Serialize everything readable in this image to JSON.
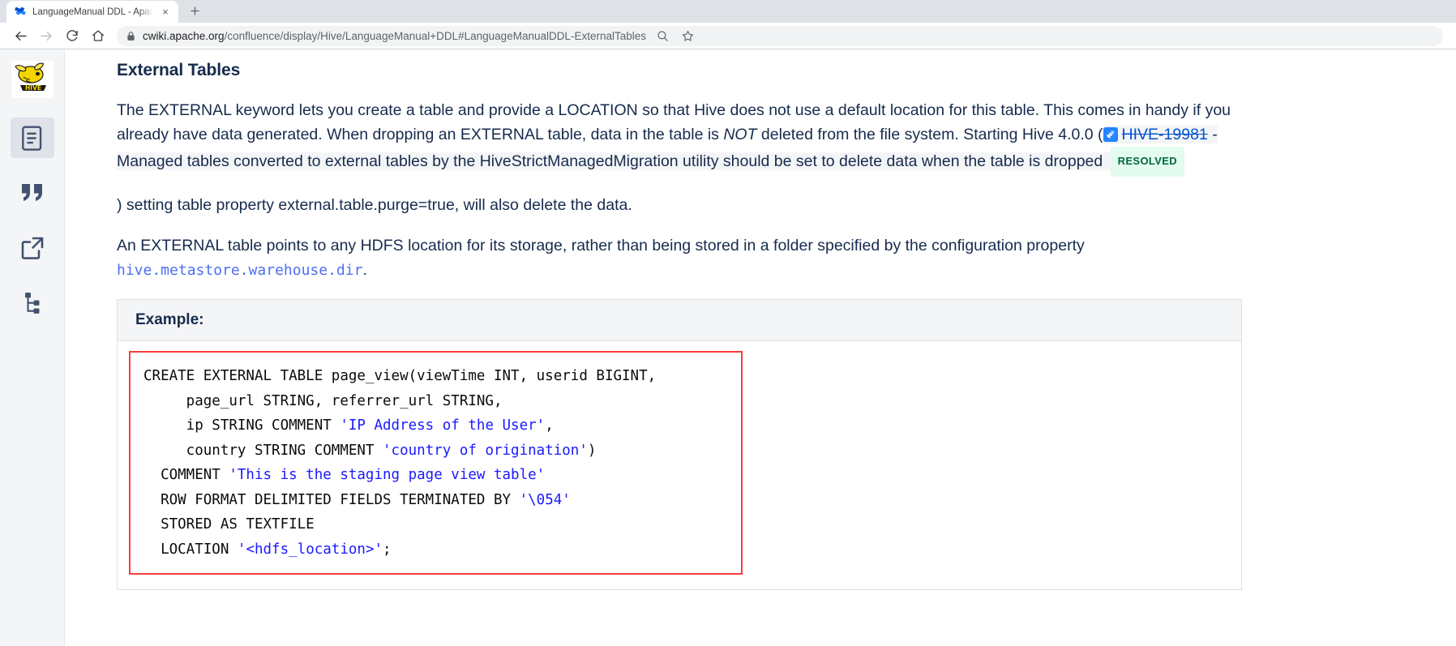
{
  "browser": {
    "tab": {
      "title": "LanguageManual DDL - Apach",
      "favicon": "confluence-icon",
      "close_label": "×"
    },
    "new_tab_label": "+",
    "nav": {
      "back": "←",
      "forward": "→",
      "reload": "↻",
      "home": "⌂"
    },
    "omnibox": {
      "lock_icon": "lock-icon",
      "host": "cwiki.apache.org",
      "path": "/confluence/display/Hive/LanguageManual+DDL#LanguageManualDDL-ExternalTables",
      "zoom_icon": "zoom-search-icon",
      "bookmark_icon": "star-icon"
    }
  },
  "sidebar": {
    "logo_alt": "hive-logo",
    "items": [
      {
        "name": "pages-icon",
        "label": "Pages",
        "active": true
      },
      {
        "name": "blog-quote-icon",
        "label": "Blog",
        "active": false
      },
      {
        "name": "external-link-icon",
        "label": "External Link",
        "active": false
      },
      {
        "name": "page-tree-icon",
        "label": "Page Tree",
        "active": false
      }
    ],
    "drag_handle": "sidebar-resize-handle"
  },
  "page": {
    "section_title": "External Tables",
    "para1_a": "The EXTERNAL keyword lets you create a table and provide a LOCATION so that Hive does not use a default location for this table. This comes in handy if you already have data generated. When dropping an EXTERNAL table, data in the table is ",
    "para1_em": "NOT",
    "para1_b": " deleted from the file system. Starting Hive 4.0.0 (",
    "jira_key": "HIVE-19981",
    "jira_text": " - Managed tables converted to external tables by the HiveStrictManagedMigration utility should be set to delete data when the table is dropped ",
    "jira_status": "RESOLVED",
    "para1_c": ") setting table property external.table.purge=true, will also delete the data.",
    "para2_a": "An EXTERNAL table points to any HDFS location for its storage, rather than being stored in a folder specified by the configuration property ",
    "para2_code": "hive.metastore.warehouse.dir",
    "para2_b": ".",
    "example_panel": {
      "heading": "Example:",
      "code_lines": [
        {
          "text": "CREATE EXTERNAL TABLE page_view(viewTime INT, userid BIGINT,",
          "strings": []
        },
        {
          "text": "     page_url STRING, referrer_url STRING,",
          "strings": []
        },
        {
          "text": "     ip STRING COMMENT 'IP Address of the User',",
          "strings": [
            "'IP Address of the User'"
          ]
        },
        {
          "text": "     country STRING COMMENT 'country of origination')",
          "strings": [
            "'country of origination'"
          ]
        },
        {
          "text": "  COMMENT 'This is the staging page view table'",
          "strings": [
            "'This is the staging page view table'"
          ]
        },
        {
          "text": "  ROW FORMAT DELIMITED FIELDS TERMINATED BY '\\054'",
          "strings": [
            "'\\054'"
          ]
        },
        {
          "text": "  STORED AS TEXTFILE",
          "strings": []
        },
        {
          "text": "  LOCATION '<hdfs_location>';",
          "strings": [
            "'<hdfs_location>'"
          ]
        }
      ]
    }
  },
  "colors": {
    "jira_link": "#0052cc",
    "badge_bg": "#e3fcef",
    "badge_text": "#006644",
    "code_border": "#fa3c3c",
    "code_string": "#1a1aff",
    "mono_link": "#4c6ef5",
    "text": "#172b4d"
  }
}
